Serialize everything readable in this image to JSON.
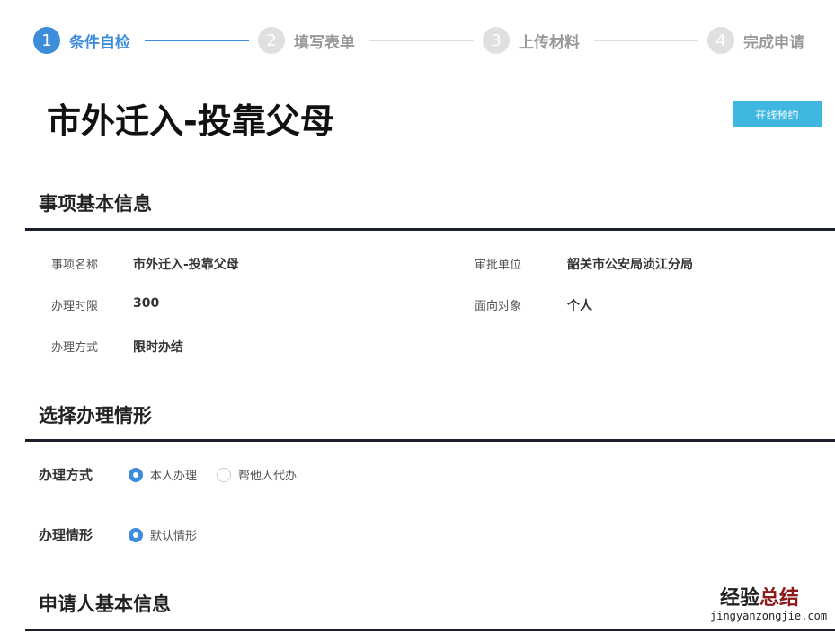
{
  "steps": [
    {
      "num": "1",
      "label": "条件自检"
    },
    {
      "num": "2",
      "label": "填写表单"
    },
    {
      "num": "3",
      "label": "上传材料"
    },
    {
      "num": "4",
      "label": "完成申请"
    }
  ],
  "title": "市外迁入-投靠父母",
  "book_button": "在线预约",
  "basic": {
    "heading": "事项基本信息",
    "rows": [
      {
        "label": "事项名称",
        "value": "市外迁入-投靠父母"
      },
      {
        "label": "审批单位",
        "value": "韶关市公安局浈江分局"
      },
      {
        "label": "办理时限",
        "value": "300"
      },
      {
        "label": "面向对象",
        "value": "个人"
      },
      {
        "label": "办理方式",
        "value": "限时办结"
      }
    ]
  },
  "situation": {
    "heading": "选择办理情形",
    "method": {
      "label": "办理方式",
      "options": [
        "本人办理",
        "帮他人代办"
      ],
      "selected": "本人办理"
    },
    "case": {
      "label": "办理情形",
      "options": [
        "默认情形"
      ],
      "selected": "默认情形"
    }
  },
  "applicant": {
    "heading": "申请人基本信息"
  },
  "watermark": {
    "cn1": "经验",
    "cn2": "总结",
    "url": "jingyanzongjie.com"
  },
  "colors": {
    "accent": "#3d8ddb",
    "button": "#3fb7e0"
  }
}
